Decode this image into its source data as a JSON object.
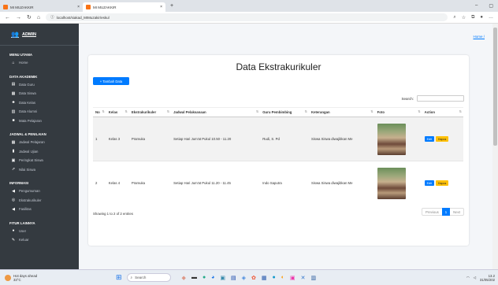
{
  "browser": {
    "tabs": [
      {
        "label": "MI MUZAKKIR",
        "close": "×"
      },
      {
        "label": "MI MUZAKKIR",
        "close": "×"
      }
    ],
    "new_tab": "+",
    "url": "localhost/siakad_MIMuzakir/eskul",
    "win_min": "–",
    "win_max": "▢"
  },
  "sidebar": {
    "brand": "ADMIN",
    "sections": [
      {
        "title": "MENU UTAMA",
        "items": [
          {
            "icon": "home-icon",
            "glyph": "⌂",
            "label": "Home"
          }
        ]
      },
      {
        "title": "DATA AKADEMIK",
        "items": [
          {
            "icon": "teacher-icon",
            "glyph": "▤",
            "label": "Data Guru"
          },
          {
            "icon": "students-icon",
            "glyph": "▦",
            "label": "Data Siswa"
          },
          {
            "icon": "class-icon",
            "glyph": "♣",
            "label": "Data Kelas"
          },
          {
            "icon": "alumni-icon",
            "glyph": "▥",
            "label": "Data Alumni"
          },
          {
            "icon": "subject-icon",
            "glyph": "■",
            "label": "Mata Pelajaran"
          }
        ]
      },
      {
        "title": "JADWAL & PENILAIAN",
        "items": [
          {
            "icon": "schedule-icon",
            "glyph": "▦",
            "label": "Jadwal Pelajaran"
          },
          {
            "icon": "exam-icon",
            "glyph": "▮",
            "label": "Jadwal Ujian"
          },
          {
            "icon": "rank-icon",
            "glyph": "▣",
            "label": "Peringkat Siswa"
          },
          {
            "icon": "grades-icon",
            "glyph": "⇗",
            "label": "Nilai Siswa"
          }
        ]
      },
      {
        "title": "INFORMASI",
        "items": [
          {
            "icon": "announcement-icon",
            "glyph": "◀",
            "label": "Pengumuman"
          },
          {
            "icon": "extracurricular-icon",
            "glyph": "◎",
            "label": "Ekstrakurikuler"
          },
          {
            "icon": "facilities-icon",
            "glyph": "◀",
            "label": "Fasilitas"
          }
        ]
      },
      {
        "title": "FITUR LAINNYA",
        "items": [
          {
            "icon": "user-icon",
            "glyph": "●",
            "label": "User"
          },
          {
            "icon": "logout-icon",
            "glyph": "✎",
            "label": "Keluar"
          }
        ]
      }
    ]
  },
  "main": {
    "home_link": "Home /",
    "title": "Data Ekstrakurikuler",
    "add_button": "+ Tambah Data",
    "search_label": "Search:",
    "columns": [
      "No",
      "Kelas",
      "Ekstrakurikuler",
      "Jadwal Pelaksanaan",
      "Guru Pembimbing",
      "Keterangan",
      "Foto",
      "Action"
    ],
    "rows": [
      {
        "no": "1",
        "kelas": "Kelas 3",
        "eskul": "Pramuka",
        "jadwal": "Setiap Hari Jum'at Pukul 10.50 - 11.20",
        "guru": "Rudi, S. Pd",
        "ket": "Siswa Siswa diwajibkan Me"
      },
      {
        "no": "2",
        "kelas": "Kelas 4",
        "eskul": "Pramuka",
        "jadwal": "Setiap Hari Jum'at Pukul 11.20 - 11.45",
        "guru": "Indo Saputra",
        "ket": "Siswa Siswa diwajibkan Me"
      }
    ],
    "edit_label": "Edit",
    "delete_label": "Hapus",
    "info": "Showing 1 to 2 of 2 entries",
    "pager": {
      "prev": "Previous",
      "page": "1",
      "next": "Next"
    }
  },
  "taskbar": {
    "weather_title": "Hot days ahead",
    "weather_temp": "33°C",
    "search": "Search",
    "time": "13.2",
    "date": "31/05/202"
  }
}
